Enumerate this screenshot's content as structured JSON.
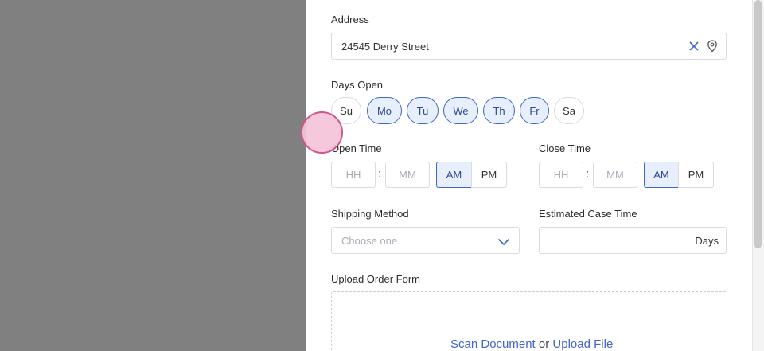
{
  "address": {
    "label": "Address",
    "value": "24545 Derry Street"
  },
  "days_open": {
    "label": "Days Open",
    "days": [
      {
        "label": "Su",
        "selected": false
      },
      {
        "label": "Mo",
        "selected": true
      },
      {
        "label": "Tu",
        "selected": true
      },
      {
        "label": "We",
        "selected": true
      },
      {
        "label": "Th",
        "selected": true
      },
      {
        "label": "Fr",
        "selected": true
      },
      {
        "label": "Sa",
        "selected": false
      }
    ]
  },
  "open_time": {
    "label": "Open Time",
    "hour_placeholder": "HH",
    "minute_placeholder": "MM",
    "separator": ":",
    "am": "AM",
    "pm": "PM",
    "selected": "AM"
  },
  "close_time": {
    "label": "Close Time",
    "hour_placeholder": "HH",
    "minute_placeholder": "MM",
    "separator": ":",
    "am": "AM",
    "pm": "PM",
    "selected": "AM"
  },
  "shipping": {
    "label": "Shipping Method",
    "placeholder": "Choose one"
  },
  "case_time": {
    "label": "Estimated Case Time",
    "unit": "Days"
  },
  "upload": {
    "label": "Upload Order Form",
    "scan_link": "Scan Document",
    "or_text": "or",
    "upload_link": "Upload File"
  },
  "colors": {
    "accent": "#3f66c9",
    "selected_bg": "#e7eefc",
    "backdrop": "#808080",
    "cursor": "#d0558f"
  },
  "icons": [
    "clear-icon",
    "location-pin-icon",
    "chevron-down-icon"
  ]
}
